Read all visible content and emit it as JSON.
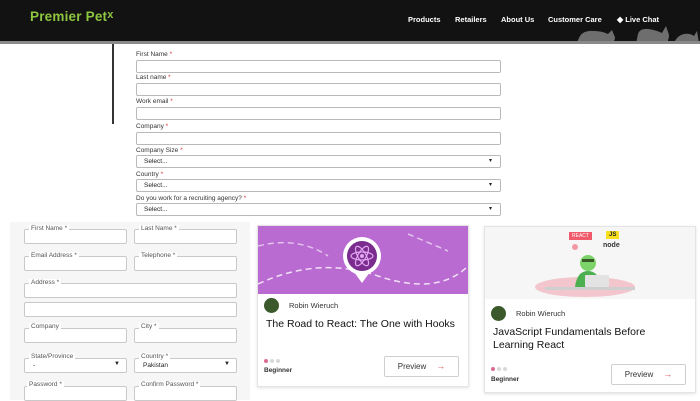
{
  "header": {
    "logo": "Premier Pet",
    "logo_mark": "x",
    "nav": [
      "Products",
      "Retailers",
      "About Us",
      "Customer Care"
    ],
    "live_chat": "Live Chat"
  },
  "form1": {
    "fields": [
      {
        "label": "First Name",
        "req": "*"
      },
      {
        "label": "Last name",
        "req": "*"
      },
      {
        "label": "Work email",
        "req": "*"
      },
      {
        "label": "Company",
        "req": "*"
      }
    ],
    "selects": [
      {
        "label": "Company Size",
        "req": "*",
        "value": "Select..."
      },
      {
        "label": "Country",
        "req": "*",
        "value": "Select..."
      },
      {
        "label": "Do you work for a recruiting agency?",
        "req": "*",
        "value": "Select..."
      }
    ]
  },
  "form2": {
    "first_name": "First Name *",
    "last_name": "Last Name *",
    "email": "Email Address *",
    "telephone": "Telephone *",
    "address": "Address *",
    "company": "Company",
    "city": "City *",
    "state": "State/Province",
    "state_value": "-",
    "country": "Country *",
    "country_value": "Pakistan",
    "password": "Password *",
    "confirm_password": "Confirm Password *"
  },
  "cards": [
    {
      "author": "Robin Wieruch",
      "title": "The Road to React: The One with Hooks",
      "level": "Beginner",
      "button": "Preview",
      "image_color": "#b96bd1"
    },
    {
      "author": "Robin Wieruch",
      "title": "JavaScript Fundamentals Before Learning React",
      "level": "Beginner",
      "button": "Preview",
      "tags": [
        "REACT",
        "JS",
        "node"
      ]
    }
  ],
  "colors": {
    "brand": "#8ec63f",
    "header_bg": "#121212",
    "card_purple": "#b96bd1",
    "accent_red": "#e05050"
  }
}
